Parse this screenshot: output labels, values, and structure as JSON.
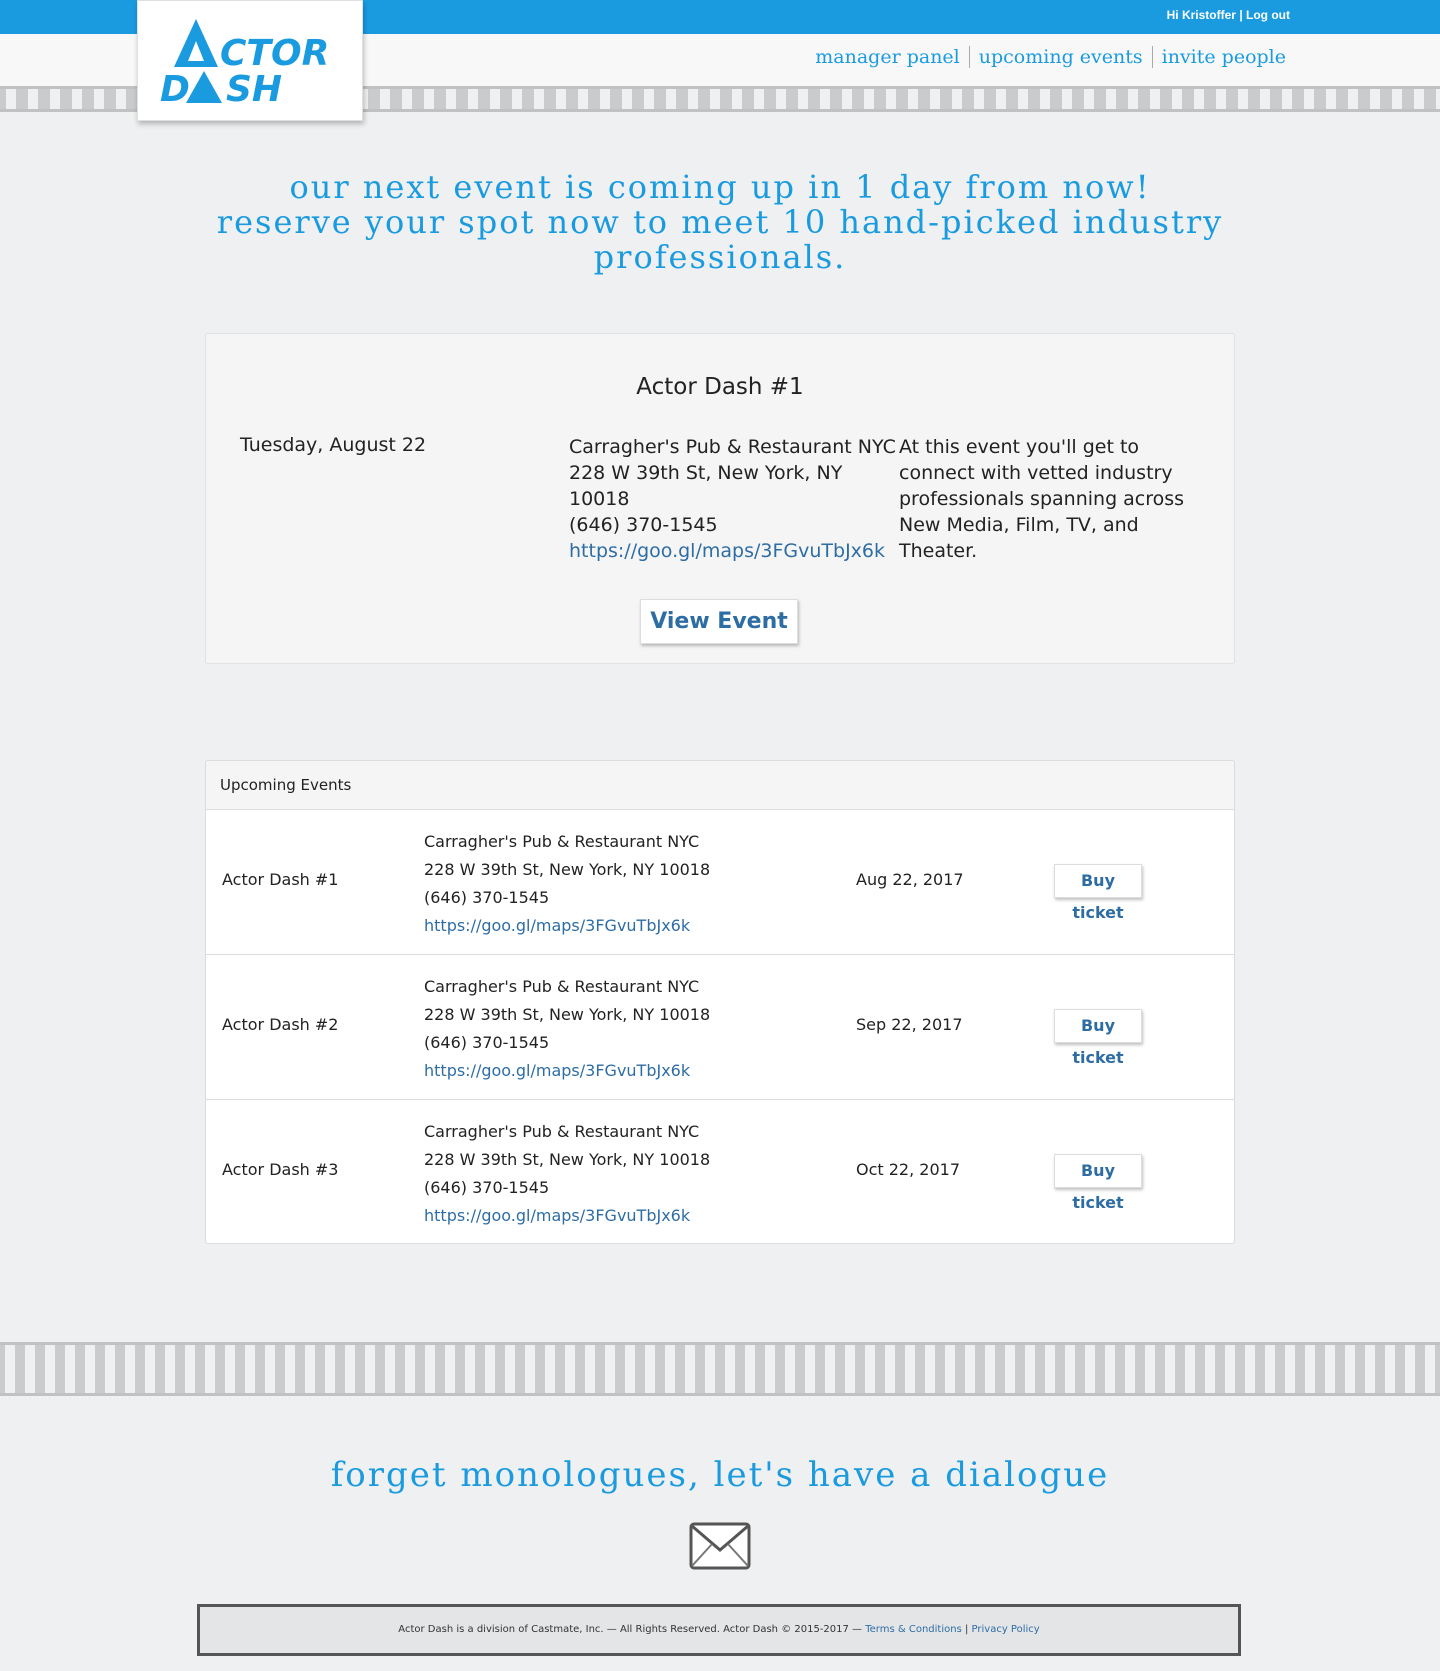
{
  "topbar": {
    "greeting": "Hi Kristoffer",
    "divider": "|",
    "logout": "Log out"
  },
  "logo": {
    "line1": "CTOR",
    "line2_a": "D",
    "line2_b": "SH",
    "color": "#1a9be0"
  },
  "nav": {
    "items": [
      "manager panel",
      "upcoming events",
      "invite people"
    ]
  },
  "hero": {
    "line1": "our next event is coming up in 1 day from now!",
    "line2": "reserve your spot now to meet 10 hand-picked industry professionals."
  },
  "featured": {
    "title": "Actor Dash #1",
    "date": "Tuesday, August 22",
    "venue_name": "Carragher's Pub & Restaurant NYC",
    "address": "228 W 39th St, New York, NY 10018",
    "phone": "(646) 370-1545",
    "map_link": "https://goo.gl/maps/3FGvuTbJx6k",
    "description": "At this event you'll get to connect with vetted industry professionals spanning across New Media, Film, TV, and Theater.",
    "view_button": "View Event"
  },
  "upcoming": {
    "heading": "Upcoming Events",
    "rows": [
      {
        "name": "Actor Dash #1",
        "venue": "Carragher's Pub & Restaurant NYC",
        "address": "228 W 39th St, New York, NY 10018",
        "phone": "(646) 370-1545",
        "link": "https://goo.gl/maps/3FGvuTbJx6k",
        "date": "Aug 22, 2017",
        "button": "Buy ticket"
      },
      {
        "name": "Actor Dash #2",
        "venue": "Carragher's Pub & Restaurant NYC",
        "address": "228 W 39th St, New York, NY 10018",
        "phone": "(646) 370-1545",
        "link": "https://goo.gl/maps/3FGvuTbJx6k",
        "date": "Sep 22, 2017",
        "button": "Buy ticket"
      },
      {
        "name": "Actor Dash #3",
        "venue": "Carragher's Pub & Restaurant NYC",
        "address": "228 W 39th St, New York, NY 10018",
        "phone": "(646) 370-1545",
        "link": "https://goo.gl/maps/3FGvuTbJx6k",
        "date": "Oct 22, 2017",
        "button": "Buy ticket"
      }
    ]
  },
  "tagline": "forget monologues, let's have a dialogue",
  "footer": {
    "text": "Actor Dash is a division of Castmate, Inc. — All Rights Reserved. Actor Dash © 2015-2017 —",
    "terms": "Terms & Conditions",
    "divider": "|",
    "privacy": "Privacy Policy"
  },
  "colors": {
    "brand_blue": "#1a9be0",
    "link_blue": "#2e6da4"
  }
}
